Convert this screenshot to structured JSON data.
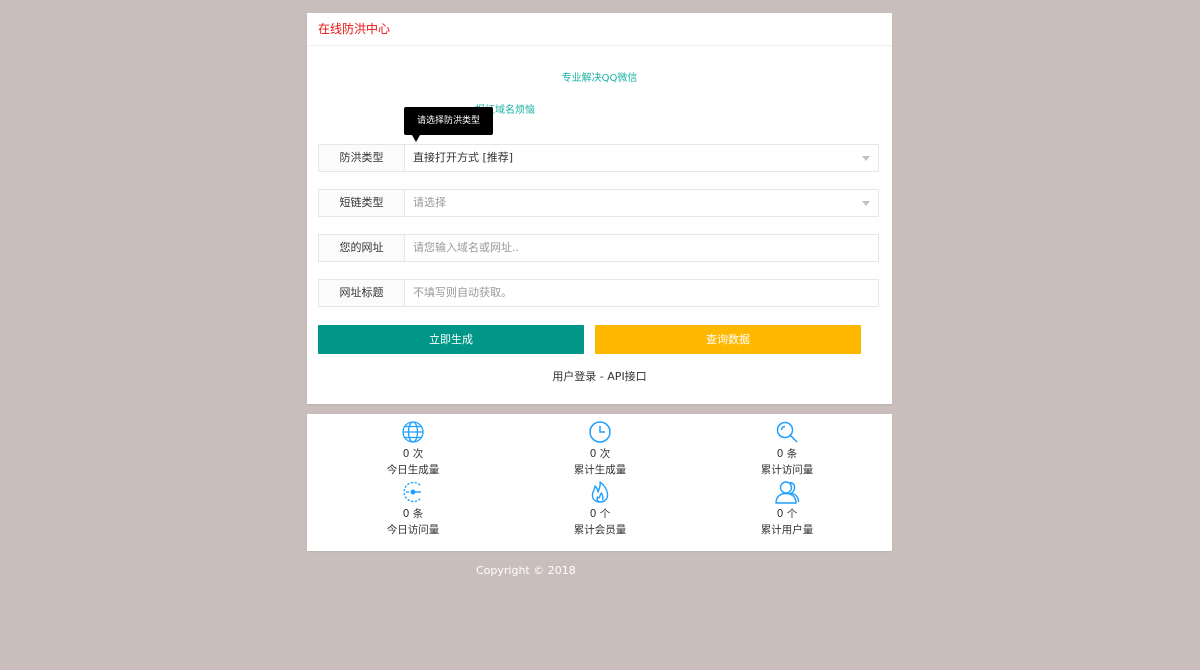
{
  "header": {
    "title": "在线防洪中心"
  },
  "tips": {
    "line1": "专业解决QQ微信",
    "line2": "报红域名烦恼"
  },
  "tooltip": {
    "text": "请选择防洪类型"
  },
  "form": {
    "type_label": "防洪类型",
    "type_value": "直接打开方式 [推荐]",
    "short_label": "短链类型",
    "short_value": "请选择",
    "url_label": "您的网址",
    "url_placeholder": "请您输入域名或网址..",
    "title_label": "网址标题",
    "title_placeholder": "不填写则自动获取。"
  },
  "buttons": {
    "generate": "立即生成",
    "query": "查询数据"
  },
  "links": {
    "login": "用户登录",
    "separator": " - ",
    "api": "API接口"
  },
  "stats": [
    {
      "icon": "globe-icon",
      "value": "0 次",
      "label": "今日生成量"
    },
    {
      "icon": "clock-icon",
      "value": "0 次",
      "label": "累计生成量"
    },
    {
      "icon": "search-icon",
      "value": "0 条",
      "label": "累计访问量"
    },
    {
      "icon": "speed-icon",
      "value": "0 条",
      "label": "今日访问量"
    },
    {
      "icon": "fire-icon",
      "value": "0 个",
      "label": "累计会员量"
    },
    {
      "icon": "users-icon",
      "value": "0 个",
      "label": "累计用户量"
    }
  ],
  "footer": {
    "copyright": "Copyright © 2018"
  },
  "colors": {
    "background": "#c9bebb",
    "title_red": "#e8130f",
    "tip_teal": "#1ab1a3",
    "button_green": "#009688",
    "button_yellow": "#ffb800",
    "icon_blue": "#1e9fff"
  }
}
